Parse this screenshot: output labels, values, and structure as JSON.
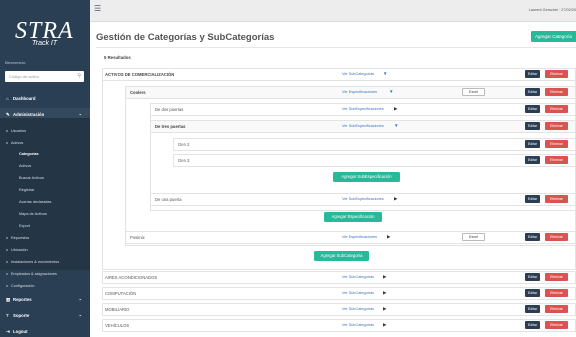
{
  "sidebar": {
    "logo_main": "STRA",
    "logo_sub": "Track IT",
    "welcome": "Bienvenido:",
    "search_placeholder": "Código de activo",
    "dashboard": "Dashboard",
    "administracion": "Administración",
    "items": [
      "Usuarios",
      "Activos",
      "Categorías",
      "Activos",
      "Buscar Activos",
      "Registrar",
      "Avarías declaradas",
      "Mapa de Activos",
      "Export",
      "Repuestos",
      "Ubicación",
      "Instalaciones & movimientos",
      "Empleados & asignaciones",
      "Configuración"
    ],
    "reportes": "Reportes",
    "soporte": "Soporte",
    "logout": "Logout"
  },
  "topbar": {
    "user": "Laurent Gerschel · 27/02/20"
  },
  "page": {
    "title": "Gestión de Categorías y SubCategorías",
    "add_category": "Agregar Categoría",
    "results": "5 Resultados"
  },
  "links": {
    "sub": "Ver SubCategorías",
    "spec": "Ver Especificaciones",
    "subspec": "Ver SubEspecificaciones"
  },
  "btn": {
    "edit": "Editar",
    "delete": "Eliminar",
    "excel": "Excel",
    "add_subspec": "Agregar SubEspecificación",
    "add_spec": "Agregar Especificación",
    "add_subcat": "Agregar SubCategoría"
  },
  "rows": {
    "cat1": "ACTIVOS DE COMERCIALIZACIÓN",
    "spec1": "Coolers",
    "sub1": "De dos puertas",
    "sub2": "De tres puertas",
    "g1": "Gen 2",
    "g2": "Gen 3",
    "sub3": "De una puerta",
    "spec2": "Posimix",
    "cat2": "AIRES ACONDICIONADOS",
    "cat3": "COMPUTACIÓN",
    "cat4": "MOBILIARIO",
    "cat5": "VEHÍCULOS"
  }
}
